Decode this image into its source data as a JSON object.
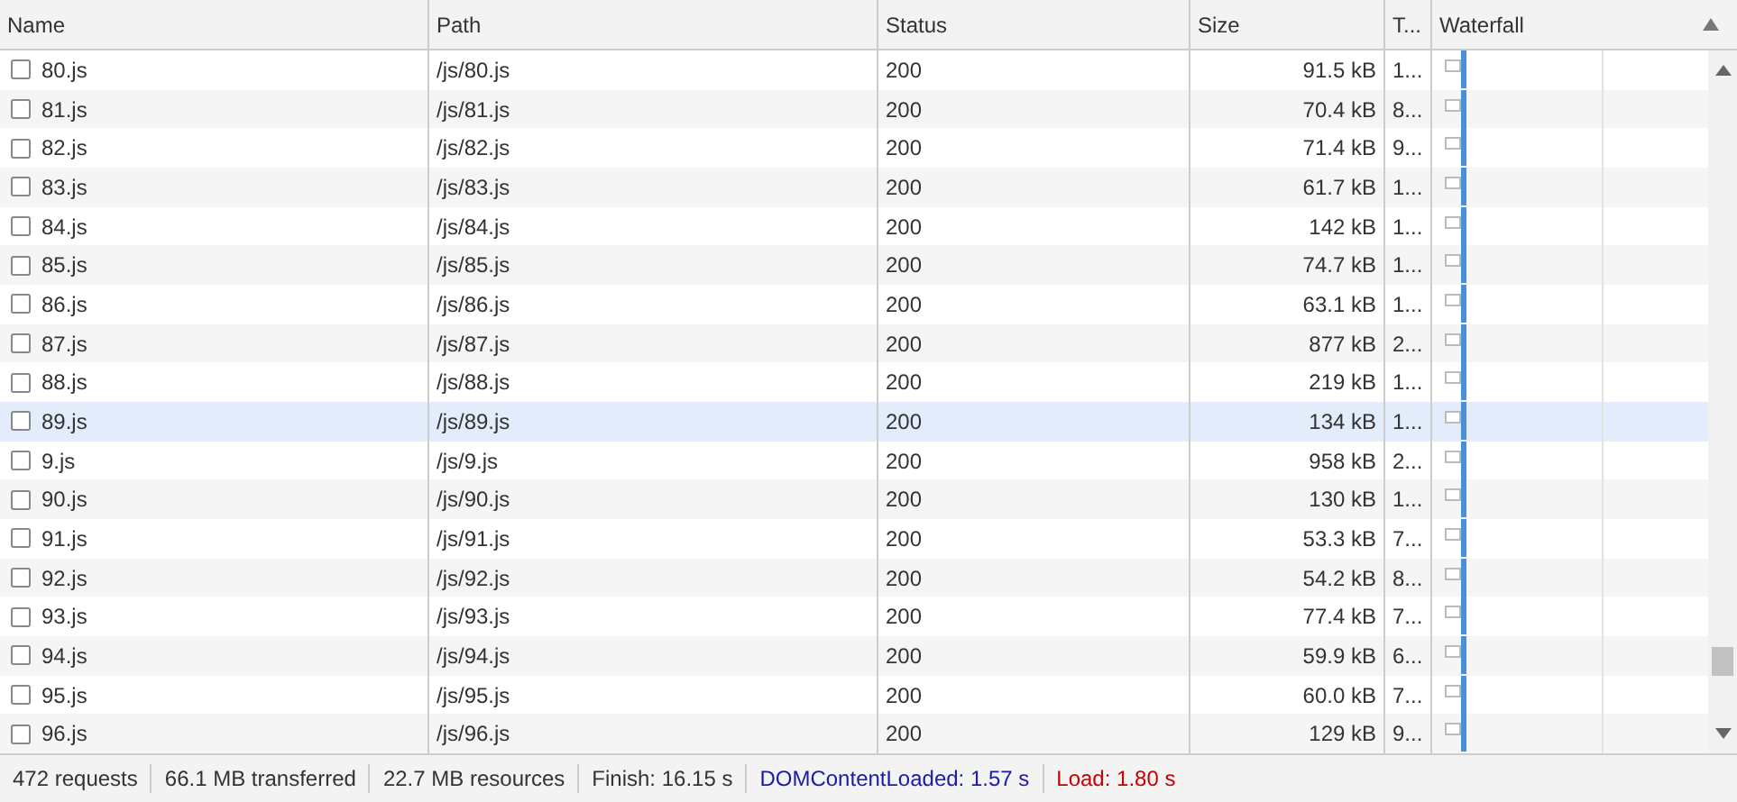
{
  "table": {
    "columns": [
      {
        "label": "Name"
      },
      {
        "label": "Path"
      },
      {
        "label": "Status"
      },
      {
        "label": "Size"
      },
      {
        "label": "T..."
      },
      {
        "label": "Waterfall",
        "sorted": true
      }
    ],
    "rows": [
      {
        "name": "80.js",
        "path": "/js/80.js",
        "status": "200",
        "size": "91.5 kB",
        "time": "1...",
        "selected": false
      },
      {
        "name": "81.js",
        "path": "/js/81.js",
        "status": "200",
        "size": "70.4 kB",
        "time": "8...",
        "selected": false
      },
      {
        "name": "82.js",
        "path": "/js/82.js",
        "status": "200",
        "size": "71.4 kB",
        "time": "9...",
        "selected": false
      },
      {
        "name": "83.js",
        "path": "/js/83.js",
        "status": "200",
        "size": "61.7 kB",
        "time": "1...",
        "selected": false
      },
      {
        "name": "84.js",
        "path": "/js/84.js",
        "status": "200",
        "size": "142 kB",
        "time": "1...",
        "selected": false
      },
      {
        "name": "85.js",
        "path": "/js/85.js",
        "status": "200",
        "size": "74.7 kB",
        "time": "1...",
        "selected": false
      },
      {
        "name": "86.js",
        "path": "/js/86.js",
        "status": "200",
        "size": "63.1 kB",
        "time": "1...",
        "selected": false
      },
      {
        "name": "87.js",
        "path": "/js/87.js",
        "status": "200",
        "size": "877 kB",
        "time": "2...",
        "selected": false
      },
      {
        "name": "88.js",
        "path": "/js/88.js",
        "status": "200",
        "size": "219 kB",
        "time": "1...",
        "selected": false
      },
      {
        "name": "89.js",
        "path": "/js/89.js",
        "status": "200",
        "size": "134 kB",
        "time": "1...",
        "selected": true
      },
      {
        "name": "9.js",
        "path": "/js/9.js",
        "status": "200",
        "size": "958 kB",
        "time": "2...",
        "selected": false
      },
      {
        "name": "90.js",
        "path": "/js/90.js",
        "status": "200",
        "size": "130 kB",
        "time": "1...",
        "selected": false
      },
      {
        "name": "91.js",
        "path": "/js/91.js",
        "status": "200",
        "size": "53.3 kB",
        "time": "7...",
        "selected": false
      },
      {
        "name": "92.js",
        "path": "/js/92.js",
        "status": "200",
        "size": "54.2 kB",
        "time": "8...",
        "selected": false
      },
      {
        "name": "93.js",
        "path": "/js/93.js",
        "status": "200",
        "size": "77.4 kB",
        "time": "7...",
        "selected": false
      },
      {
        "name": "94.js",
        "path": "/js/94.js",
        "status": "200",
        "size": "59.9 kB",
        "time": "6...",
        "selected": false
      },
      {
        "name": "95.js",
        "path": "/js/95.js",
        "status": "200",
        "size": "60.0 kB",
        "time": "7...",
        "selected": false
      },
      {
        "name": "96.js",
        "path": "/js/96.js",
        "status": "200",
        "size": "129 kB",
        "time": "9...",
        "selected": false
      }
    ]
  },
  "status_bar": [
    {
      "text": "472 requests",
      "color": "#333333"
    },
    {
      "text": "66.1 MB transferred",
      "color": "#333333"
    },
    {
      "text": "22.7 MB resources",
      "color": "#333333"
    },
    {
      "text": "Finish: 16.15 s",
      "color": "#333333"
    },
    {
      "text": "DOMContentLoaded: 1.57 s",
      "color": "#1a1aa6"
    },
    {
      "text": "Load: 1.80 s",
      "color": "#c80000"
    }
  ]
}
